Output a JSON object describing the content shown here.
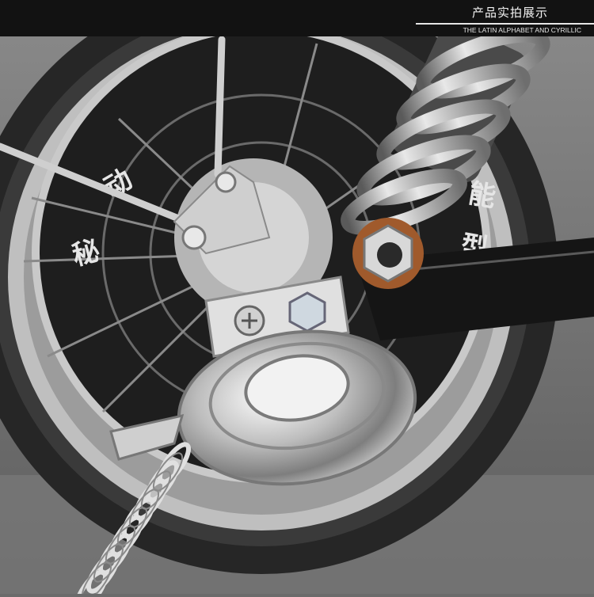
{
  "banner": {
    "title": "产品实拍展示",
    "subtitle": "THE LATIN ALPHABET AND CYRILLIC"
  },
  "photo": {
    "subject": "motorcycle rear wheel hub with chrome kickstand bracket, spring and shock absorber",
    "hub_text": [
      "能",
      "型",
      "动",
      "秘"
    ]
  }
}
